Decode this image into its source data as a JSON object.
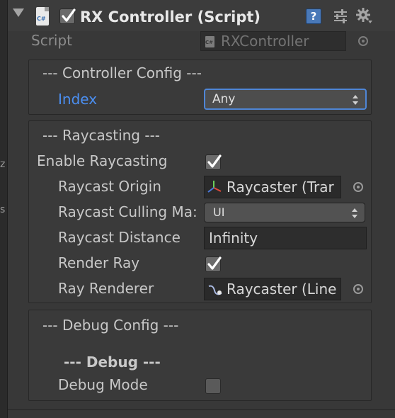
{
  "left_edge": {
    "glyphs": [
      "z",
      "s"
    ]
  },
  "header": {
    "title": "RX Controller (Script)",
    "enabled": true,
    "script_icon_label": "C#",
    "icons": [
      "foldout-arrow-icon",
      "csharp-file-icon",
      "help-book-icon",
      "preset-sliders-icon",
      "gear-icon"
    ]
  },
  "script_row": {
    "label": "Script",
    "value": "RXController",
    "icon_label": "C#"
  },
  "controller_config": {
    "header": "--- Controller Config ---",
    "index": {
      "label": "Index",
      "value": "Any"
    }
  },
  "raycasting": {
    "header": "--- Raycasting ---",
    "enable": {
      "label": "Enable Raycasting",
      "checked": true
    },
    "origin": {
      "label": "Raycast Origin",
      "value": "Raycaster (Trar"
    },
    "culling_mask": {
      "label": "Raycast Culling Ma:",
      "value": "UI"
    },
    "distance": {
      "label": "Raycast Distance",
      "value": "Infinity"
    },
    "render_ray": {
      "label": "Render Ray",
      "checked": true
    },
    "ray_renderer": {
      "label": "Ray Renderer",
      "value": "Raycaster (Line"
    }
  },
  "debug_config": {
    "header": "--- Debug Config ---",
    "sub_header": "--- Debug ---",
    "debug_mode": {
      "label": "Debug Mode",
      "checked": false
    }
  },
  "colors": {
    "background": "#383838",
    "panel": "#3a3a3a",
    "accent_blue": "#4b8ff2",
    "text": "#c8c8c8",
    "focus_outline": "#4f86d6"
  }
}
